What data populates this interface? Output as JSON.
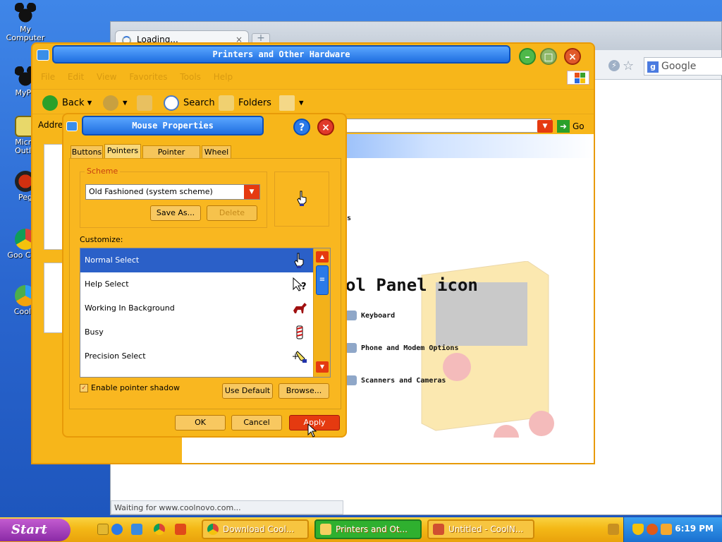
{
  "desktop": {
    "icons": [
      {
        "label": "My Computer"
      },
      {
        "label": "MyPa"
      },
      {
        "label": "Micro Outlo"
      },
      {
        "label": "Peg"
      },
      {
        "label": "Goo Chro"
      },
      {
        "label": "CoolN"
      }
    ]
  },
  "chrome": {
    "tab_title": "Loading...",
    "tab_close": "×",
    "new_tab": "+",
    "search_placeholder": "Google",
    "status_text": "Waiting for www.coolnovo.com..."
  },
  "explorer": {
    "title": "Printers and Other Hardware",
    "menu": [
      "File",
      "Edit",
      "View",
      "Favorites",
      "Tools",
      "Help"
    ],
    "toolbar": {
      "back": "Back",
      "search": "Search",
      "folders": "Folders"
    },
    "address_label": "Address",
    "go_label": "Go",
    "content": {
      "heading": "ol Panel icon",
      "fragment": "ers",
      "items": [
        "Keyboard",
        "Phone and Modem Options",
        "Scanners and Cameras"
      ]
    }
  },
  "dialog": {
    "title": "Mouse Properties",
    "tabs": [
      "Buttons",
      "Pointers",
      "Pointer Options",
      "Wheel"
    ],
    "active_tab": "Pointers",
    "scheme_label": "Scheme",
    "scheme_value": "Old Fashioned (system scheme)",
    "save_as": "Save As...",
    "delete": "Delete",
    "customize_label": "Customize:",
    "pointers": [
      {
        "name": "Normal Select",
        "icon": "hand-pointer-icon",
        "selected": true
      },
      {
        "name": "Help Select",
        "icon": "help-pointer-icon",
        "selected": false
      },
      {
        "name": "Working In Background",
        "icon": "horse-icon",
        "selected": false
      },
      {
        "name": "Busy",
        "icon": "barber-pole-icon",
        "selected": false
      },
      {
        "name": "Precision Select",
        "icon": "pen-icon",
        "selected": false
      }
    ],
    "shadow_checkbox": "Enable pointer shadow",
    "shadow_checked": true,
    "use_default": "Use Default",
    "browse": "Browse...",
    "ok": "OK",
    "cancel": "Cancel",
    "apply": "Apply"
  },
  "taskbar": {
    "start": "Start",
    "buttons": [
      {
        "label": "Download Cool..."
      },
      {
        "label": "Printers and Ot..."
      },
      {
        "label": "Untitled - CoolN..."
      }
    ],
    "clock": "6:19 PM"
  },
  "colors": {
    "accent": "#f7b61a",
    "title_blue": "#1f6ee0",
    "selection": "#2b60c8",
    "danger": "#e53a10"
  }
}
